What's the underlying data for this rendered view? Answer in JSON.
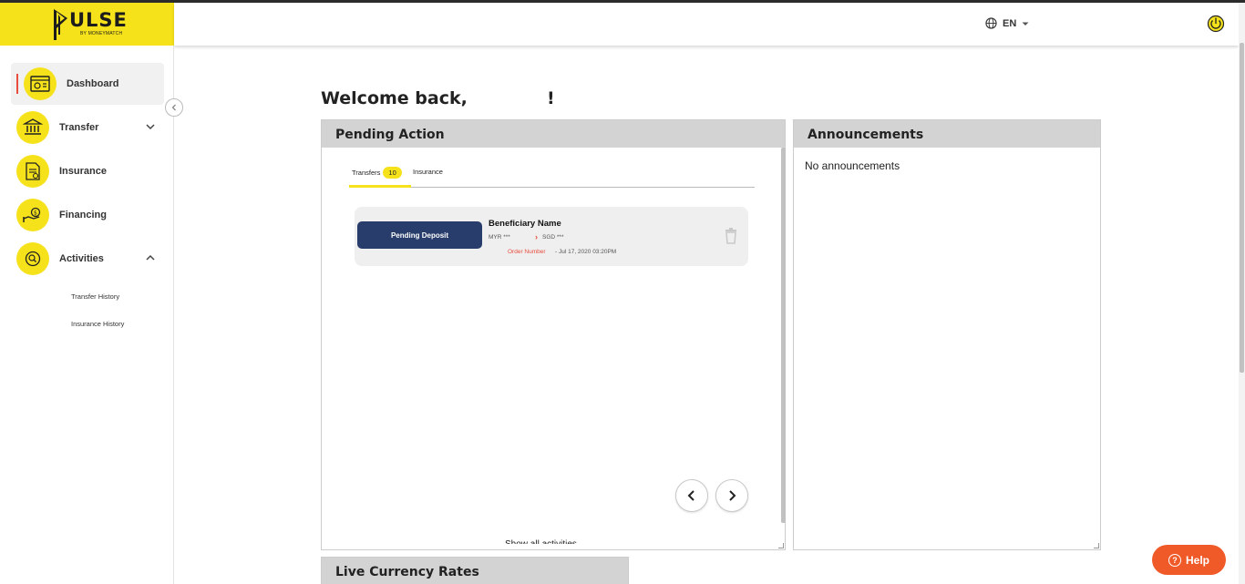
{
  "brand": {
    "name": "ULSE",
    "tagline": "BY MONEYMATCH",
    "color": "#f5e21b"
  },
  "topbar": {
    "language": "EN"
  },
  "sidebar": {
    "items": [
      {
        "label": "Dashboard",
        "icon": "dashboard-icon",
        "active": true
      },
      {
        "label": "Transfer",
        "icon": "bank-icon",
        "expanded": false
      },
      {
        "label": "Insurance",
        "icon": "insurance-document-icon"
      },
      {
        "label": "Financing",
        "icon": "financing-hand-icon"
      },
      {
        "label": "Activities",
        "icon": "activities-search-icon",
        "expanded": true
      }
    ],
    "sub_items": [
      "Transfer History",
      "Insurance History"
    ]
  },
  "main": {
    "welcome": "Welcome back,",
    "welcome_end": "!",
    "pending": {
      "title": "Pending Action",
      "tabs": [
        {
          "label": "Transfers",
          "count": "10",
          "active": true
        },
        {
          "label": "Insurance"
        }
      ],
      "card": {
        "status": "Pending Deposit",
        "beneficiary": "Beneficiary Name",
        "from_currency": "MYR ***",
        "to_currency": "SGD ***",
        "order_label": "Order Number",
        "order_date": "- Jul 17, 2020 03:20PM"
      },
      "show_all": "Show all activities"
    },
    "announcements": {
      "title": "Announcements",
      "empty_text": "No announcements"
    },
    "rates": {
      "title": "Live Currency Rates"
    }
  },
  "help": {
    "label": "Help"
  },
  "colors": {
    "accent_yellow": "#f5e21b",
    "navy": "#283d6b",
    "orange": "#f05a28",
    "red": "#e84c3d"
  }
}
